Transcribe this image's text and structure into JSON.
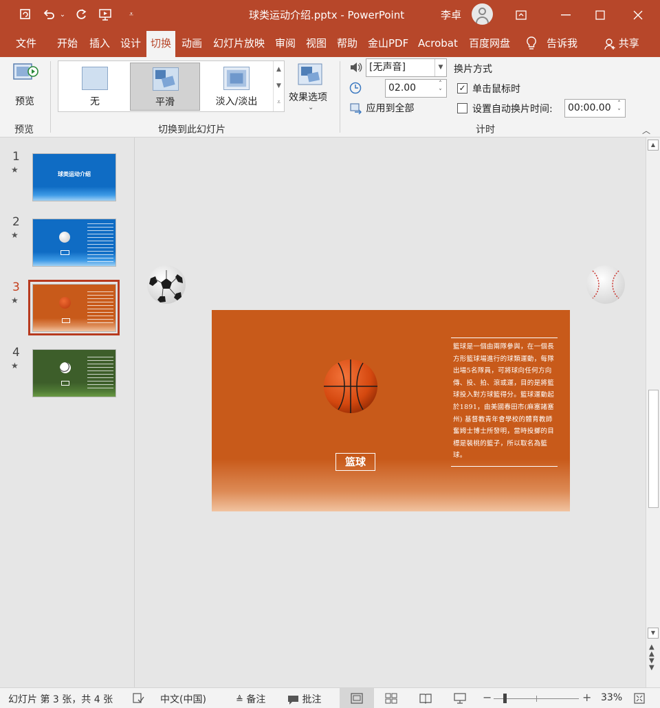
{
  "window": {
    "title": "球类运动介绍.pptx - PowerPoint",
    "user": "李卓"
  },
  "tabs": [
    "文件",
    "开始",
    "插入",
    "设计",
    "切换",
    "动画",
    "幻灯片放映",
    "审阅",
    "视图",
    "帮助",
    "金山PDF",
    "Acrobat",
    "百度网盘",
    "告诉我",
    "共享"
  ],
  "active_tab": "切换",
  "ribbon": {
    "preview_label": "预览",
    "preview_group": "预览",
    "gallery": {
      "items": [
        "无",
        "平滑",
        "淡入/淡出"
      ],
      "selected": "平滑"
    },
    "effect_options": "效果选项",
    "transition_group": "切换到此幻灯片",
    "sound": "[无声音]",
    "duration": "02.00",
    "apply_all": "应用到全部",
    "advance_title": "换片方式",
    "on_click": "单击鼠标时",
    "on_click_checked": true,
    "auto_after": "设置自动换片时间:",
    "auto_after_checked": false,
    "auto_time": "00:00.00",
    "timing_group": "计时"
  },
  "slides": [
    {
      "number": "1",
      "title": "球类运动介绍",
      "theme": "blue"
    },
    {
      "number": "2",
      "theme": "blue"
    },
    {
      "number": "3",
      "theme": "orange",
      "active": true
    },
    {
      "number": "4",
      "theme": "green"
    }
  ],
  "current_slide": {
    "title": "篮球",
    "body": "籃球是一個由兩隊參與，在一個長方形籃球場進行的球類運動，每隊出場5名隊員，可將球向任何方向傳、投、拍、滾或運，目的是將籃球投入對方球籃得分。籃球運動起於1891，由美國春田市(麻塞諸塞州) 基督教青年會學校的體育教師奮姆士博士所發明，當時投擲的目標是裝桃的籃子，所以取名為籃球。"
  },
  "status": {
    "slide_info": "幻灯片 第 3 张，共 4 张",
    "language": "中文(中国)",
    "notes": "备注",
    "comments": "批注",
    "zoom": "33%"
  },
  "colors": {
    "accent": "#b7472a",
    "slide_orange": "#c85a1a",
    "slide_blue": "#0f6cc4",
    "slide_green": "#3d5e2a"
  }
}
